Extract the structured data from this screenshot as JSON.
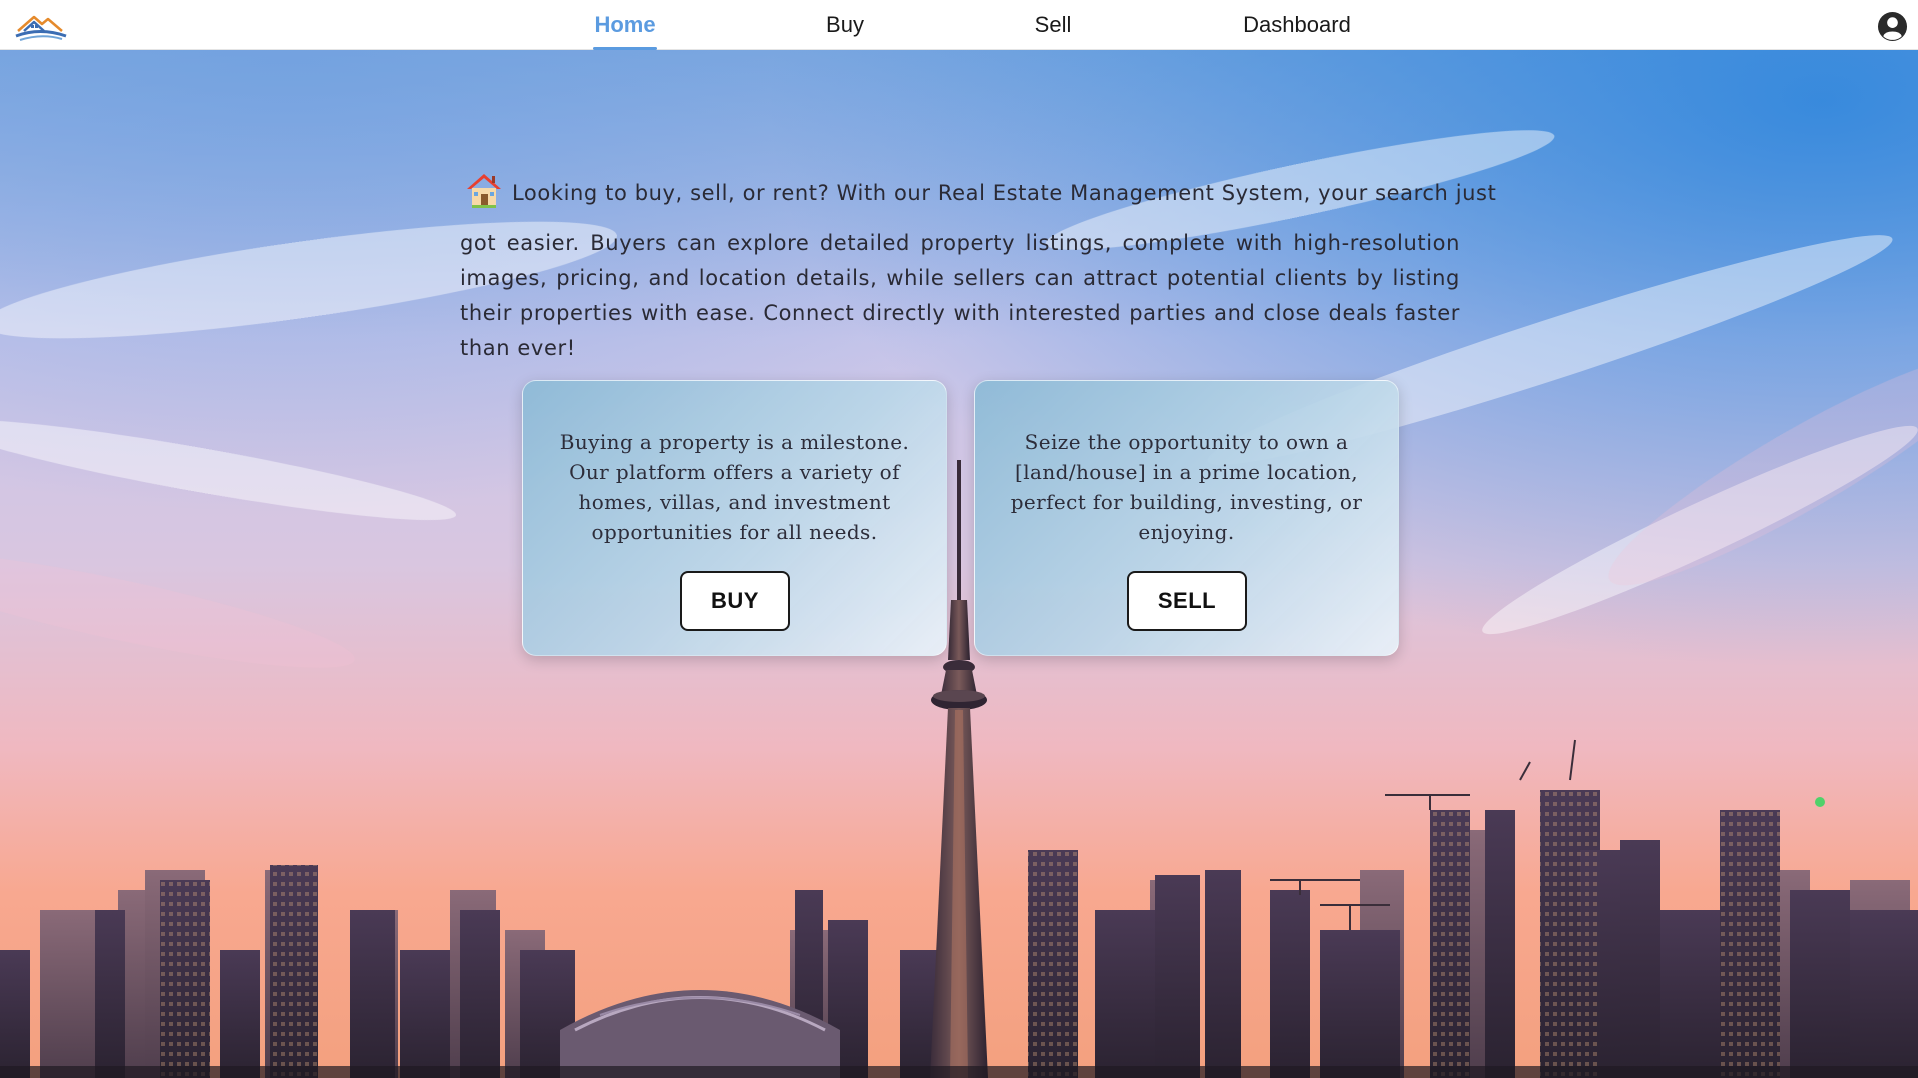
{
  "nav": {
    "logo_icon": "house-roof-wave-logo",
    "links": [
      {
        "label": "Home",
        "active": true
      },
      {
        "label": "Buy",
        "active": false
      },
      {
        "label": "Sell",
        "active": false
      },
      {
        "label": "Dashboard",
        "active": false
      }
    ],
    "account_icon": "user-circle-icon",
    "accent_color": "#5b9be0"
  },
  "intro": {
    "icon": "house-emoji",
    "first_line": "Looking to buy, sell, or rent? With our Real Estate Management System, your search just",
    "rest": "got easier. Buyers can explore detailed property listings, complete with high-resolution images, pricing, and location details, while sellers can attract potential clients by listing their properties with ease. Connect directly with interested parties and close deals faster than ever!"
  },
  "cards": {
    "buy": {
      "text": "Buying a property is a milestone. Our platform offers a variety of homes, villas, and investment opportunities for all needs.",
      "button_label": "BUY"
    },
    "sell": {
      "text": "Seize the opportunity to own a [land/house] in a prime location, perfect for building, investing, or enjoying.",
      "button_label": "SELL"
    }
  },
  "background": {
    "scene": "city-skyline-at-sunset-with-tower",
    "sky_top_color": "#4a8fd8",
    "sky_bottom_color": "#f3a88f"
  }
}
